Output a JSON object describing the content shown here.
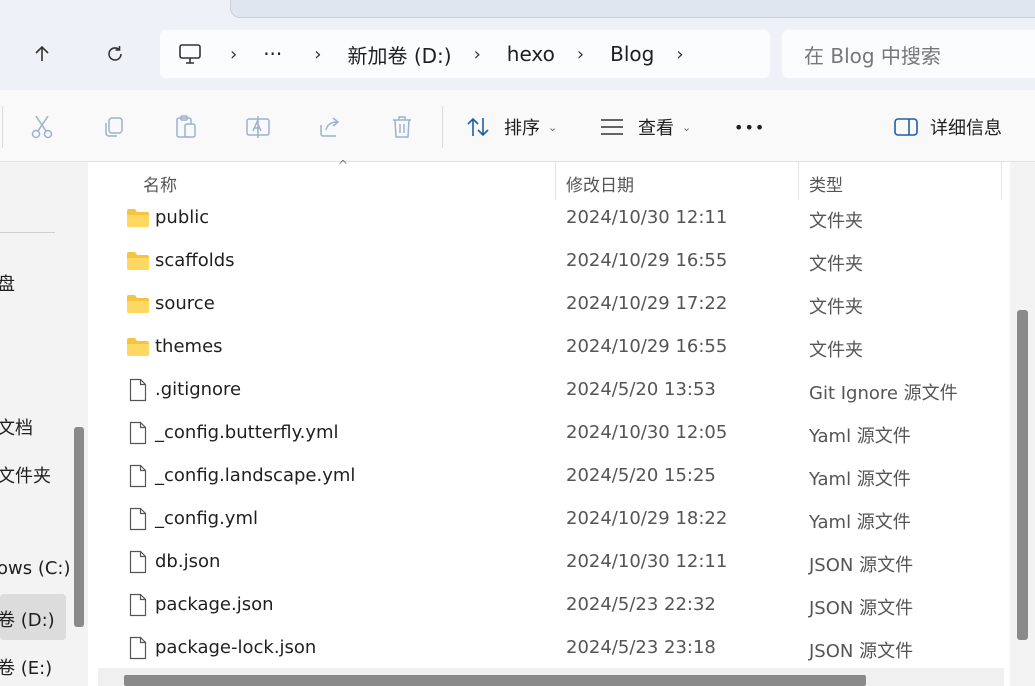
{
  "address_bar": {
    "crumbs": [
      "新加卷 (D:)",
      "hexo",
      "Blog"
    ],
    "overflow": "···"
  },
  "search": {
    "placeholder": "在 Blog 中搜索"
  },
  "toolbar": {
    "sort_label": "排序",
    "view_label": "查看",
    "more_label": "•••",
    "details_label": "详细信息"
  },
  "nav_pane": {
    "items": [
      "盘",
      "文档",
      "文件夹",
      "ows  (C:)",
      "卷 (D:)",
      "卷 (E:)"
    ]
  },
  "columns": {
    "name": "名称",
    "date": "修改日期",
    "type": "类型"
  },
  "files": [
    {
      "name": "public",
      "date": "2024/10/30 12:11",
      "type": "文件夹",
      "icon": "folder-icon"
    },
    {
      "name": "scaffolds",
      "date": "2024/10/29 16:55",
      "type": "文件夹",
      "icon": "folder-icon"
    },
    {
      "name": "source",
      "date": "2024/10/29 17:22",
      "type": "文件夹",
      "icon": "folder-icon"
    },
    {
      "name": "themes",
      "date": "2024/10/29 16:55",
      "type": "文件夹",
      "icon": "folder-icon"
    },
    {
      "name": ".gitignore",
      "date": "2024/5/20 13:53",
      "type": "Git Ignore 源文件",
      "icon": "file-icon"
    },
    {
      "name": "_config.butterfly.yml",
      "date": "2024/10/30 12:05",
      "type": "Yaml 源文件",
      "icon": "file-icon"
    },
    {
      "name": "_config.landscape.yml",
      "date": "2024/5/20 15:25",
      "type": "Yaml 源文件",
      "icon": "file-icon"
    },
    {
      "name": "_config.yml",
      "date": "2024/10/29 18:22",
      "type": "Yaml 源文件",
      "icon": "file-icon"
    },
    {
      "name": "db.json",
      "date": "2024/10/30 12:11",
      "type": "JSON 源文件",
      "icon": "file-icon"
    },
    {
      "name": "package.json",
      "date": "2024/5/23 22:32",
      "type": "JSON 源文件",
      "icon": "file-icon"
    },
    {
      "name": "package-lock.json",
      "date": "2024/5/23 23:18",
      "type": "JSON 源文件",
      "icon": "file-icon"
    }
  ],
  "colors": {
    "folder": "#f5c542",
    "accent": "#0067c0"
  }
}
